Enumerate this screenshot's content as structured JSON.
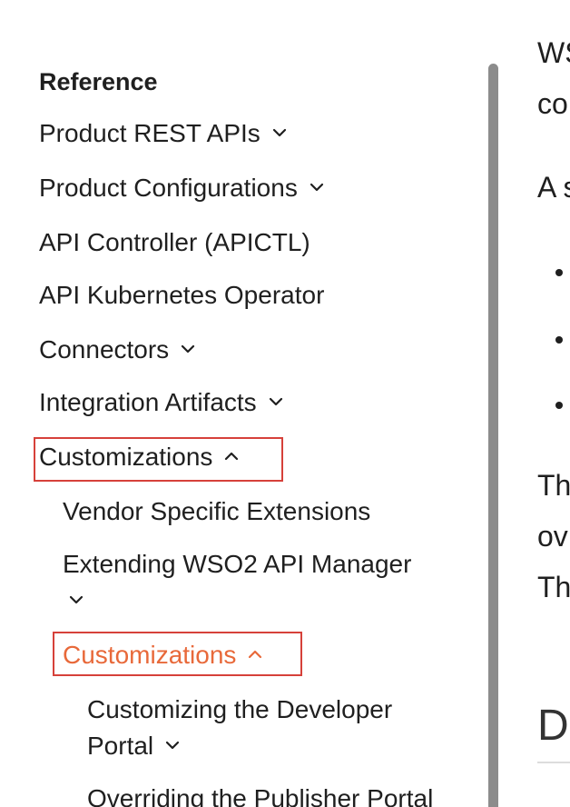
{
  "sidebar": {
    "heading": "Reference",
    "items": [
      {
        "label": "Product REST APIs"
      },
      {
        "label": "Product Configurations"
      },
      {
        "label": "API Controller (APICTL)"
      },
      {
        "label": "API Kubernetes Operator"
      },
      {
        "label": "Connectors"
      },
      {
        "label": "Integration Artifacts"
      },
      {
        "label": "Customizations"
      },
      {
        "label": "Vendor Specific Extensions"
      },
      {
        "label": "Extending WSO2 API Manager"
      },
      {
        "label": "Customizations"
      },
      {
        "label": "Customizing the Developer"
      },
      {
        "label": "Portal"
      },
      {
        "label": "Overriding the Publisher Portal"
      }
    ]
  },
  "main": {
    "fragments": [
      "WS",
      "co",
      "A s",
      "Th",
      "ov",
      "Th"
    ],
    "heading_fragment": "D"
  },
  "colors": {
    "active": "#e8693a",
    "highlight_border": "#d6413a",
    "text": "#1f1f1f",
    "scrollbar": "#8c8c8c"
  }
}
